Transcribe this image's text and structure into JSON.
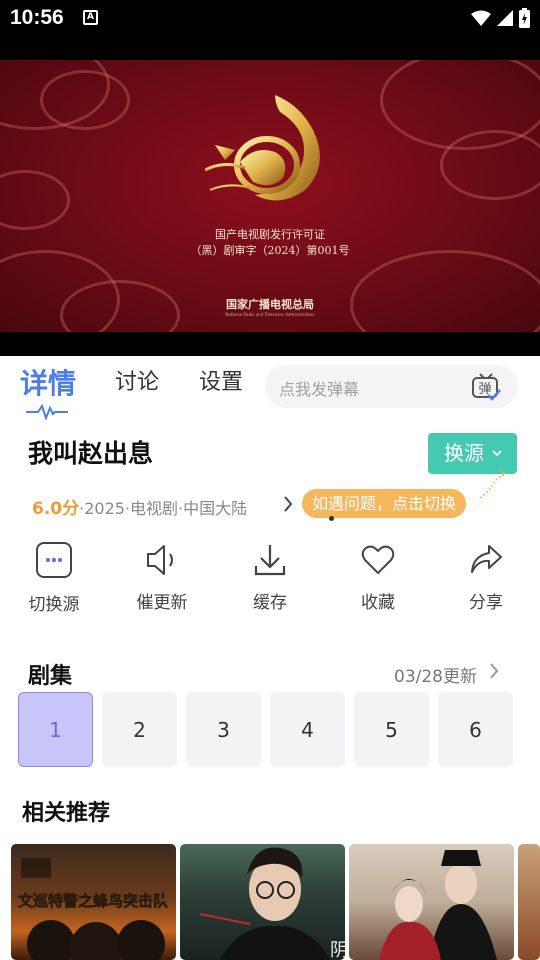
{
  "status_bar": {
    "time": "10:56",
    "notification_icon": "A",
    "icons": [
      "wifi-icon",
      "signal-icon",
      "battery-charging-icon"
    ]
  },
  "video": {
    "license_line1": "国产电视剧发行许可证",
    "license_line2": "（黑）剧审字（2024）第001号",
    "org": "国家广播电视总局",
    "org_sub": "National Radio and Television Administration"
  },
  "tabs": [
    {
      "label": "详情",
      "active": true
    },
    {
      "label": "讨论",
      "active": false
    },
    {
      "label": "设置",
      "active": false
    }
  ],
  "danmu": {
    "placeholder": "点我发弹幕",
    "icon": "danmu-tv-icon",
    "icon_char": "弹"
  },
  "show": {
    "title": "我叫赵出息",
    "score": "6.0分",
    "meta": "·2025·电视剧·中国大陆",
    "switch_source": "换源",
    "tip": "如遇问题，点击切换"
  },
  "actions": [
    {
      "label": "切换源",
      "icon": "switch-source-icon"
    },
    {
      "label": "催更新",
      "icon": "speaker-icon"
    },
    {
      "label": "缓存",
      "icon": "download-icon"
    },
    {
      "label": "收藏",
      "icon": "heart-icon"
    },
    {
      "label": "分享",
      "icon": "share-icon"
    }
  ],
  "episodes": {
    "title": "剧集",
    "updated": "03/28更新",
    "items": [
      "1",
      "2",
      "3",
      "4",
      "5",
      "6"
    ],
    "selected": "1"
  },
  "related": {
    "title": "相关推荐",
    "poster1_text": "文巡特警之蜂鸟突击队"
  },
  "colors": {
    "accent_blue": "#4a7fe8",
    "teal": "#45c9b1",
    "orange": "#f19a38",
    "tip_bg": "#f5b75c",
    "episode_active_bg": "#c8c6f8",
    "episode_active_text": "#6b66e3"
  }
}
